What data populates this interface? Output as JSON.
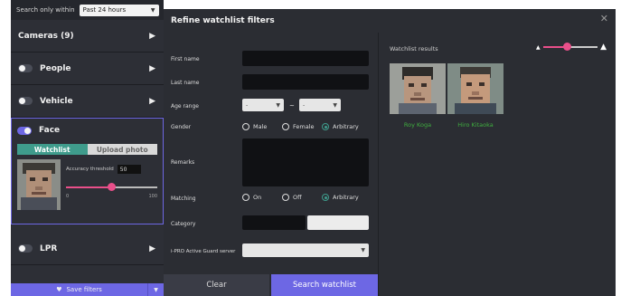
{
  "sidebar": {
    "filter_label": "Search only within",
    "time_range": "Past 24 hours",
    "sections": [
      {
        "label": "Cameras (9)"
      },
      {
        "label": "People"
      },
      {
        "label": "Vehicle"
      }
    ],
    "face": {
      "label": "Face",
      "tabs": [
        "Watchlist",
        "Upload photo"
      ],
      "accuracy_label": "Accuracy threshold",
      "accuracy_value": "50",
      "slider_min": "0",
      "slider_max": "100",
      "slider_level": 0.5
    },
    "lpr_label": "LPR",
    "save_label": "Save filters"
  },
  "dialog": {
    "title": "Refine watchlist filters",
    "labels": {
      "first_name": "First name",
      "last_name": "Last name",
      "age_range": "Age range",
      "gender": "Gender",
      "remarks": "Remarks",
      "matching": "Matching",
      "category": "Category",
      "server": "i-PRO Active Guard server"
    },
    "age_from": "-",
    "age_to": "-",
    "age_dash": "~",
    "gender_options": [
      "Male",
      "Female",
      "Arbitrary"
    ],
    "gender_selected": "Arbitrary",
    "matching_options": [
      "On",
      "Off",
      "Arbitrary"
    ],
    "matching_selected": "Arbitrary",
    "clear_label": "Clear",
    "search_label": "Search watchlist"
  },
  "results": {
    "label": "Watchlist results",
    "zoom_level": 0.45,
    "items": [
      {
        "name": "Roy Koga"
      },
      {
        "name": "Hiro Kitaoka"
      }
    ]
  },
  "colors": {
    "accent": "#6d67e4",
    "teal": "#3f9c8c",
    "slider": "#e94f8a",
    "result_name": "#3fae3f"
  }
}
